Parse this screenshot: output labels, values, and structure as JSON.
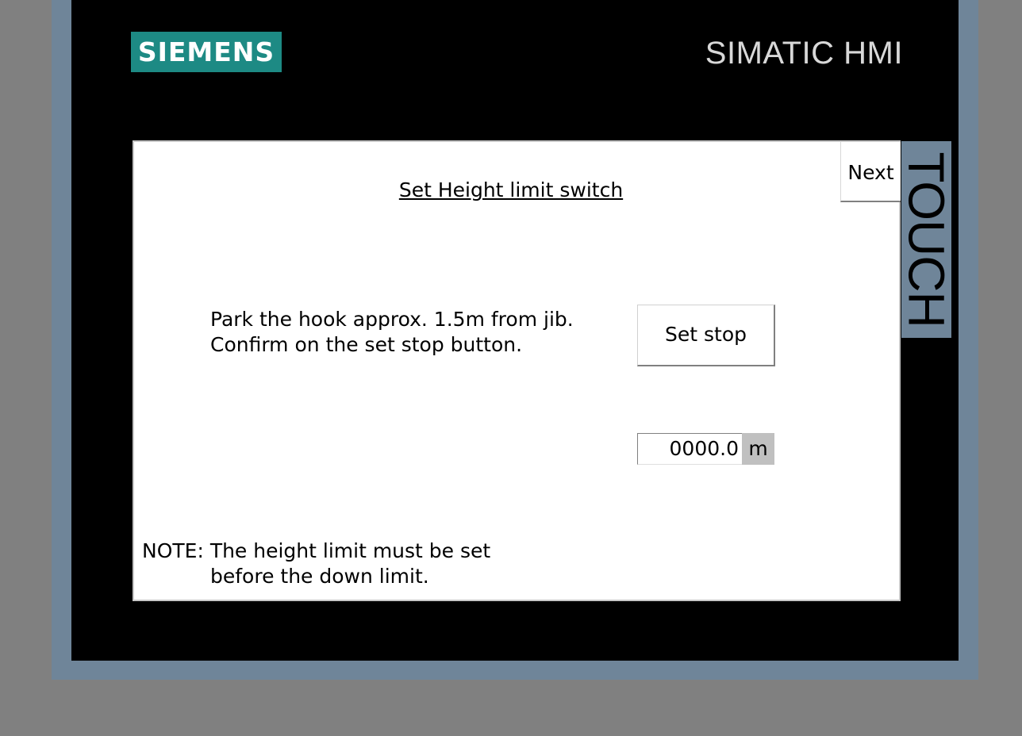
{
  "device": {
    "brand": "SIEMENS",
    "product": "SIMATIC HMI",
    "side_label": "TOUCH",
    "colors": {
      "frame": "#6f8599",
      "bezel": "#000000",
      "logo_bg": "#1d8a84",
      "background": "#808080"
    }
  },
  "screen": {
    "title": "Set Height limit switch",
    "next_label": "Next",
    "instruction_line1": "Park the hook approx. 1.5m from jib.",
    "instruction_line2": "Confirm on the set stop button.",
    "set_stop_label": "Set stop",
    "height_value": "0000.0",
    "height_unit": "m",
    "note_line1": "NOTE: The height limit must be set",
    "note_line2": "before the down limit."
  }
}
